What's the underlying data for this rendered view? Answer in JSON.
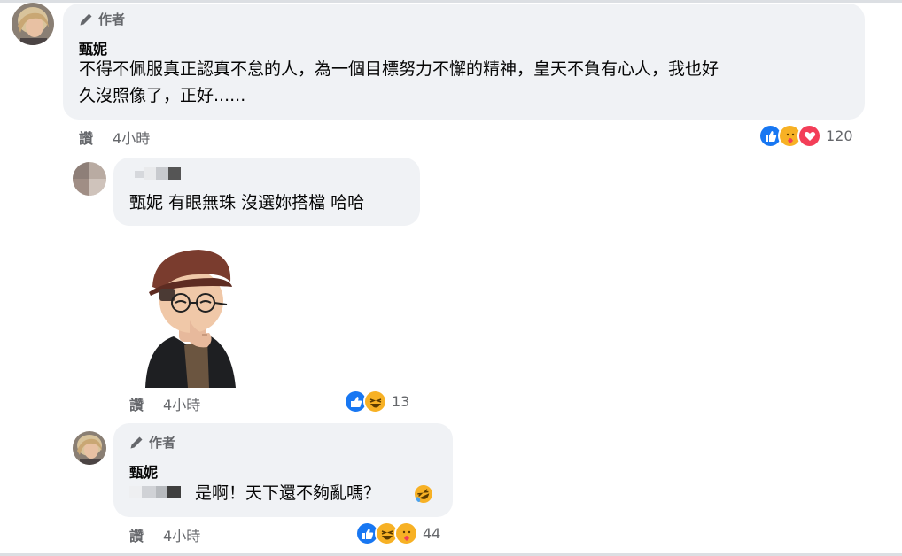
{
  "comments": [
    {
      "author_badge": "作者",
      "name": "甄妮",
      "text_line1": "不得不佩服真正認真不怠的人，為一個目標努力不懈的精神，皇天不負有心人，我也好",
      "text_line2": "久沒照像了，正好......",
      "like_label": "讚",
      "time": "4小時",
      "reaction_count": "120"
    },
    {
      "text": "甄妮 有眼無珠 沒選妳搭檔 哈哈",
      "like_label": "讚",
      "time": "4小時",
      "reaction_count": "13"
    },
    {
      "author_badge": "作者",
      "name": "甄妮",
      "text": "是啊！天下還不夠亂嗎？",
      "like_label": "讚",
      "time": "4小時",
      "reaction_count": "44"
    }
  ],
  "colors": {
    "bubble": "#f0f2f5",
    "like_blue": "#1877f2",
    "love_red": "#f33e58",
    "haha_yellow": "#f7b125",
    "meta_gray": "#65676b"
  },
  "icons": [
    "pencil-icon",
    "like-reaction-icon",
    "care-reaction-icon",
    "love-reaction-icon",
    "haha-reaction-icon",
    "rofl-emoji-icon"
  ]
}
